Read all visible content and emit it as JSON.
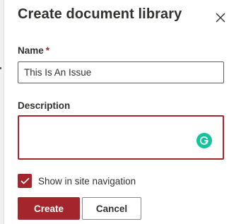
{
  "panel": {
    "title": "Create document library",
    "close_icon": "close-icon"
  },
  "form": {
    "name_label": "Name",
    "name_required_marker": "*",
    "name_value": "This Is An Issue",
    "description_label": "Description",
    "description_value": "",
    "grammarly_icon": "grammarly-icon",
    "show_in_nav_label": "Show in site navigation",
    "show_in_nav_checked": true
  },
  "actions": {
    "create_label": "Create",
    "cancel_label": "Cancel"
  },
  "colors": {
    "accent": "#a4262c",
    "text": "#323130",
    "grammarly": "#15c39a"
  }
}
